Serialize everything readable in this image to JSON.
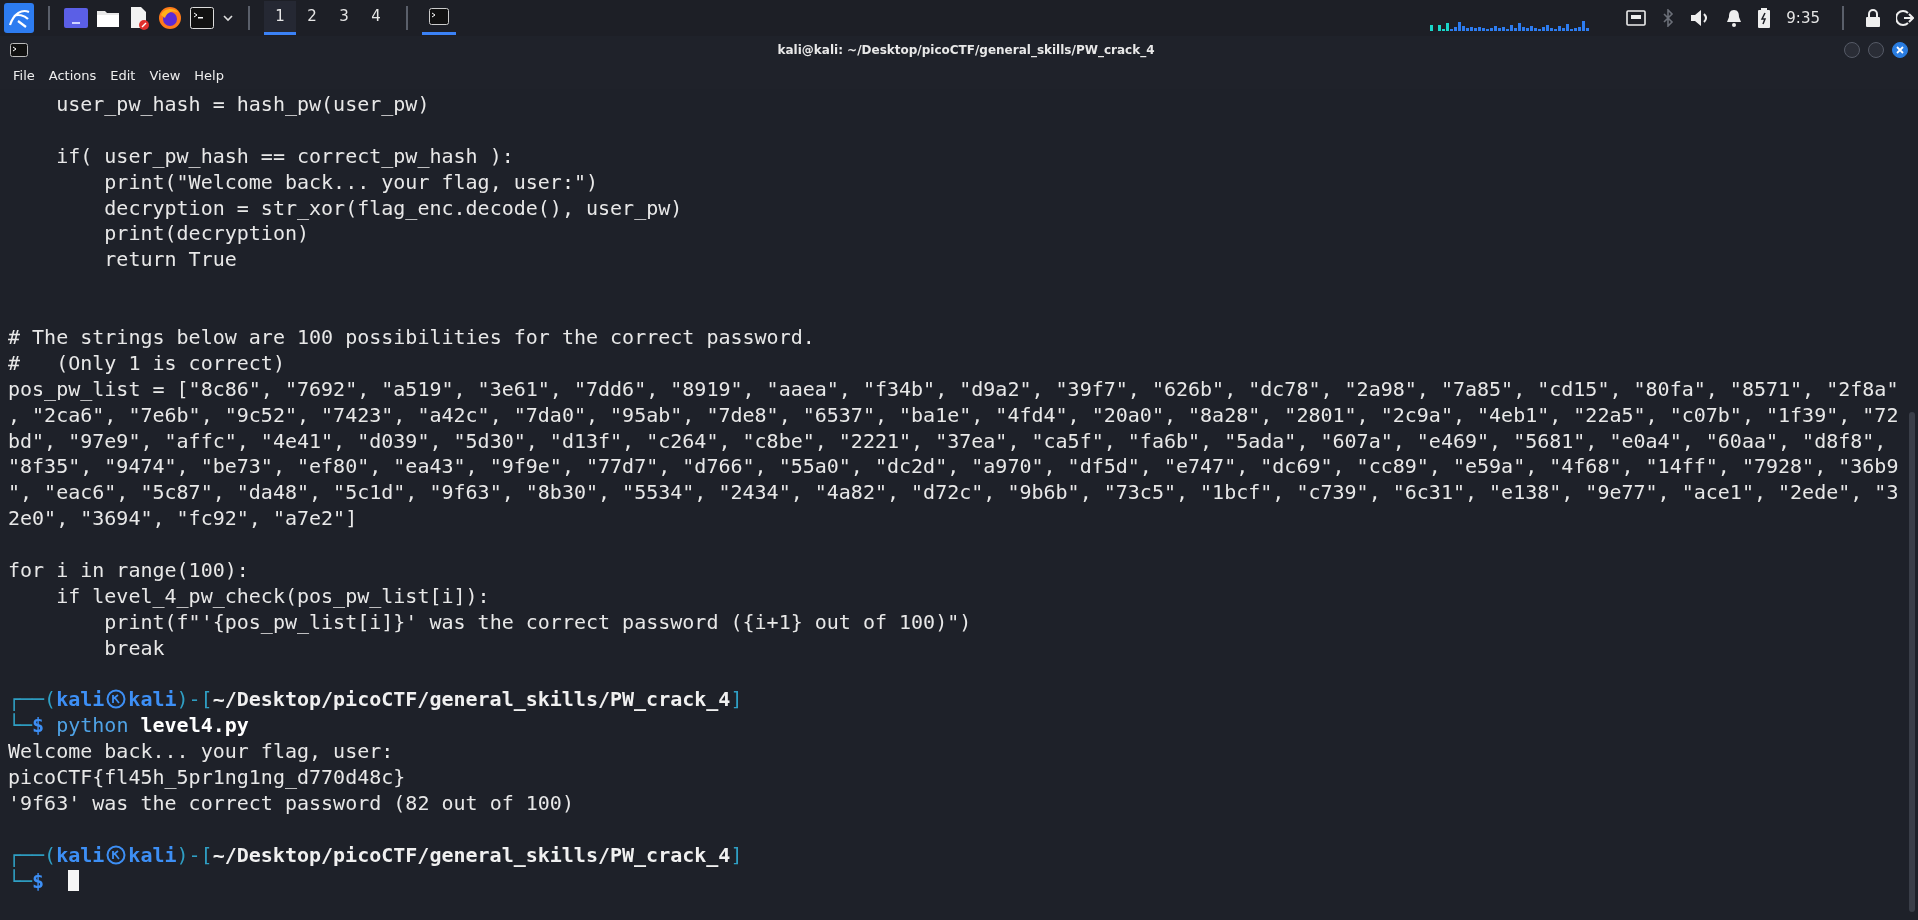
{
  "taskbar": {
    "workspaces": [
      {
        "label": "1",
        "selected": true
      },
      {
        "label": "2",
        "selected": false
      },
      {
        "label": "3",
        "selected": false
      },
      {
        "label": "4",
        "selected": false
      }
    ],
    "tasks": [
      {
        "selected": true
      }
    ],
    "tray": {
      "bluetooth_disabled": true,
      "clock": "9:35"
    }
  },
  "window": {
    "title": "kali@kali: ~/Desktop/picoCTF/general_skills/PW_crack_4",
    "menu": [
      "File",
      "Actions",
      "Edit",
      "View",
      "Help"
    ]
  },
  "terminal": {
    "lines": [
      {
        "kind": "code",
        "text": "    user_pw_hash = hash_pw(user_pw)"
      },
      {
        "kind": "blank"
      },
      {
        "kind": "code",
        "text": "    if( user_pw_hash == correct_pw_hash ):"
      },
      {
        "kind": "code",
        "text": "        print(\"Welcome back... your flag, user:\")"
      },
      {
        "kind": "code",
        "text": "        decryption = str_xor(flag_enc.decode(), user_pw)"
      },
      {
        "kind": "code",
        "text": "        print(decryption)"
      },
      {
        "kind": "code",
        "text": "        return True"
      },
      {
        "kind": "blank"
      },
      {
        "kind": "blank"
      },
      {
        "kind": "code",
        "text": "# The strings below are 100 possibilities for the correct password."
      },
      {
        "kind": "code",
        "text": "#   (Only 1 is correct)"
      },
      {
        "kind": "code",
        "text": "pos_pw_list = [\"8c86\", \"7692\", \"a519\", \"3e61\", \"7dd6\", \"8919\", \"aaea\", \"f34b\", \"d9a2\", \"39f7\", \"626b\", \"dc78\", \"2a98\", \"7a85\", \"cd15\", \"80fa\", \"8571\", \"2f8a\""
      },
      {
        "kind": "code",
        "text": ", \"2ca6\", \"7e6b\", \"9c52\", \"7423\", \"a42c\", \"7da0\", \"95ab\", \"7de8\", \"6537\", \"ba1e\", \"4fd4\", \"20a0\", \"8a28\", \"2801\", \"2c9a\", \"4eb1\", \"22a5\", \"c07b\", \"1f39\", \"72"
      },
      {
        "kind": "code",
        "text": "bd\", \"97e9\", \"affc\", \"4e41\", \"d039\", \"5d30\", \"d13f\", \"c264\", \"c8be\", \"2221\", \"37ea\", \"ca5f\", \"fa6b\", \"5ada\", \"607a\", \"e469\", \"5681\", \"e0a4\", \"60aa\", \"d8f8\","
      },
      {
        "kind": "code",
        "text": "\"8f35\", \"9474\", \"be73\", \"ef80\", \"ea43\", \"9f9e\", \"77d7\", \"d766\", \"55a0\", \"dc2d\", \"a970\", \"df5d\", \"e747\", \"dc69\", \"cc89\", \"e59a\", \"4f68\", \"14ff\", \"7928\", \"36b9"
      },
      {
        "kind": "code",
        "text": "\", \"eac6\", \"5c87\", \"da48\", \"5c1d\", \"9f63\", \"8b30\", \"5534\", \"2434\", \"4a82\", \"d72c\", \"9b6b\", \"73c5\", \"1bcf\", \"c739\", \"6c31\", \"e138\", \"9e77\", \"ace1\", \"2ede\", \"3"
      },
      {
        "kind": "code",
        "text": "2e0\", \"3694\", \"fc92\", \"a7e2\"]"
      },
      {
        "kind": "blank"
      },
      {
        "kind": "code",
        "text": "for i in range(100):"
      },
      {
        "kind": "code",
        "text": "    if level_4_pw_check(pos_pw_list[i]):"
      },
      {
        "kind": "code",
        "text": "        print(f\"'{pos_pw_list[i]}' was the correct password ({i+1} out of 100)\")"
      },
      {
        "kind": "code",
        "text": "        break"
      },
      {
        "kind": "blank"
      },
      {
        "kind": "segments",
        "segments": [
          {
            "kind": "frame",
            "text": "┌──("
          },
          {
            "kind": "user",
            "text": "kali"
          },
          {
            "kind": "symbol"
          },
          {
            "kind": "user",
            "text": "kali"
          },
          {
            "kind": "frame",
            "text": ")-["
          },
          {
            "kind": "path",
            "text": "~/Desktop/picoCTF/general_skills/PW_crack_4"
          },
          {
            "kind": "frame",
            "text": "]"
          }
        ]
      },
      {
        "kind": "segments",
        "segments": [
          {
            "kind": "frame",
            "text": "└─"
          },
          {
            "kind": "sign",
            "text": "$"
          },
          {
            "kind": "command",
            "text": "python"
          },
          {
            "kind": "argument",
            "text": "level4.py"
          }
        ]
      },
      {
        "kind": "code",
        "text": "Welcome back... your flag, user:"
      },
      {
        "kind": "code",
        "text": "picoCTF{fl45h_5pr1ng1ng_d770d48c}"
      },
      {
        "kind": "code",
        "text": "'9f63' was the correct password (82 out of 100)"
      },
      {
        "kind": "blank"
      },
      {
        "kind": "segments",
        "segments": [
          {
            "kind": "frame",
            "text": "┌──("
          },
          {
            "kind": "user",
            "text": "kali"
          },
          {
            "kind": "symbol"
          },
          {
            "kind": "user",
            "text": "kali"
          },
          {
            "kind": "frame",
            "text": ")-["
          },
          {
            "kind": "path",
            "text": "~/Desktop/picoCTF/general_skills/PW_crack_4"
          },
          {
            "kind": "frame",
            "text": "]"
          }
        ]
      },
      {
        "kind": "segments",
        "segments": [
          {
            "kind": "frame",
            "text": "└─"
          },
          {
            "kind": "sign",
            "text": "$"
          },
          {
            "kind": "cursor"
          }
        ]
      }
    ]
  }
}
